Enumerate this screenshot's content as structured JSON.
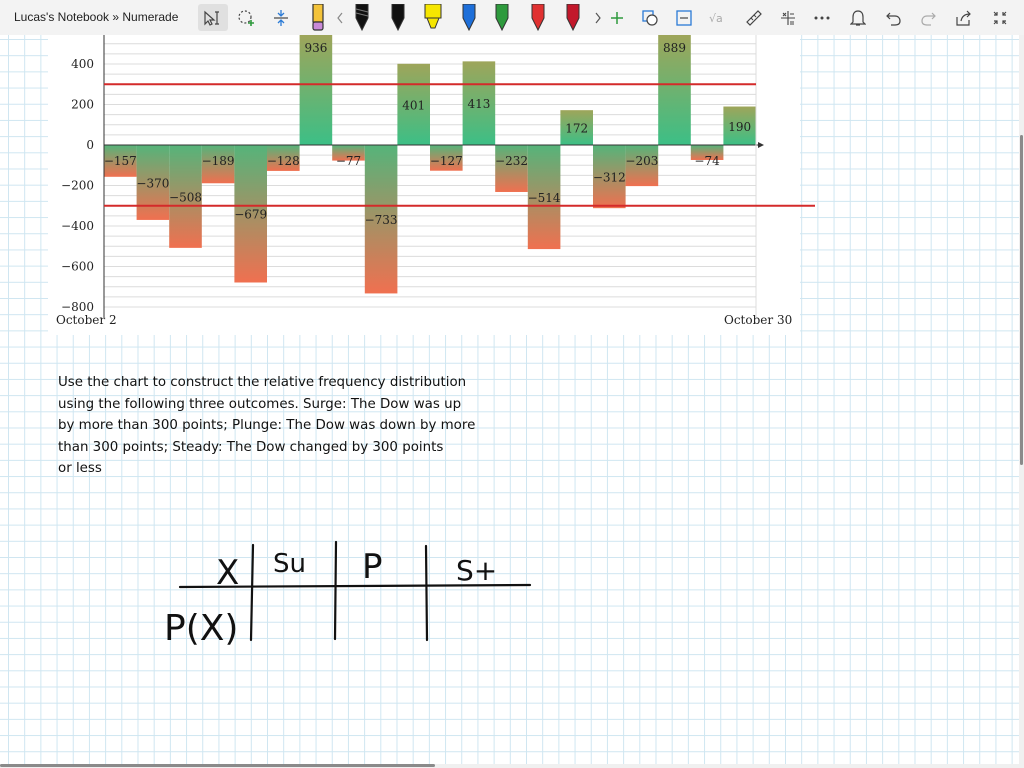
{
  "window": {
    "title": "Lucas's Notebook » Numerade"
  },
  "toolbar": {
    "colors": {
      "pen_black": "#111111",
      "highlighter_yellow": "#f6e600",
      "pen_blue": "#1e6fd9",
      "pen_green": "#2e9a3d",
      "pen_red": "#e03131",
      "pen_darkred": "#c2182b",
      "pen_pink_cap": "#c98ad8",
      "pencil_yellow": "#f3c33a",
      "accent": "#2b7bd6"
    },
    "icons": [
      "select-text-icon",
      "lasso-select-icon",
      "add-space-icon",
      "pencil-tool-icon",
      "chevron-left-icon",
      "pen-icon",
      "chevron-right-icon",
      "add-pen-icon",
      "ink-to-shape-icon",
      "ink-to-text-icon",
      "ink-to-math-icon",
      "ruler-icon",
      "math-icon",
      "more-icon",
      "notifications-icon",
      "undo-icon",
      "redo-icon",
      "share-icon",
      "fullscreen-icon"
    ]
  },
  "chart_data": {
    "type": "bar",
    "xlabel_start": "October 2",
    "xlabel_end": "October 30",
    "y_ticks": [
      400,
      200,
      0,
      -200,
      -400,
      -600,
      -800
    ],
    "y_tick_labels": [
      "400",
      "200",
      "0",
      "−200",
      "−400",
      "−600",
      "−800"
    ],
    "ylim": [
      -800,
      550
    ],
    "values": [
      -157,
      -370,
      -508,
      -189,
      -679,
      -128,
      936,
      -77,
      -733,
      401,
      -127,
      413,
      -232,
      -514,
      172,
      -312,
      -203,
      889,
      -74,
      190
    ],
    "value_labels": [
      "−157",
      "−370",
      "−508",
      "−189",
      "−679",
      "−128",
      "936",
      "−77",
      "−733",
      "401",
      "−127",
      "413",
      "−232",
      "−514",
      "172",
      "−312",
      "−203",
      "889",
      "−74",
      "190"
    ],
    "reference_lines": [
      300,
      -300
    ],
    "grid": true,
    "colors": {
      "positive": "#3cbf86",
      "negative": "#f07050",
      "reference": "#d42a2a"
    }
  },
  "question": {
    "lines": [
      "Use the chart to construct the relative frequency distribution",
      "using the following three outcomes. Surge: The Dow was up",
      "by more than 300 points; Plunge: The Dow was down by more",
      "than 300 points; Steady: The Dow changed by 300 points",
      "or less"
    ]
  },
  "handwriting": {
    "row_header": "X",
    "col_1": "Su",
    "col_2": "P",
    "col_3": "S+",
    "row_2_header": "P(X)"
  }
}
